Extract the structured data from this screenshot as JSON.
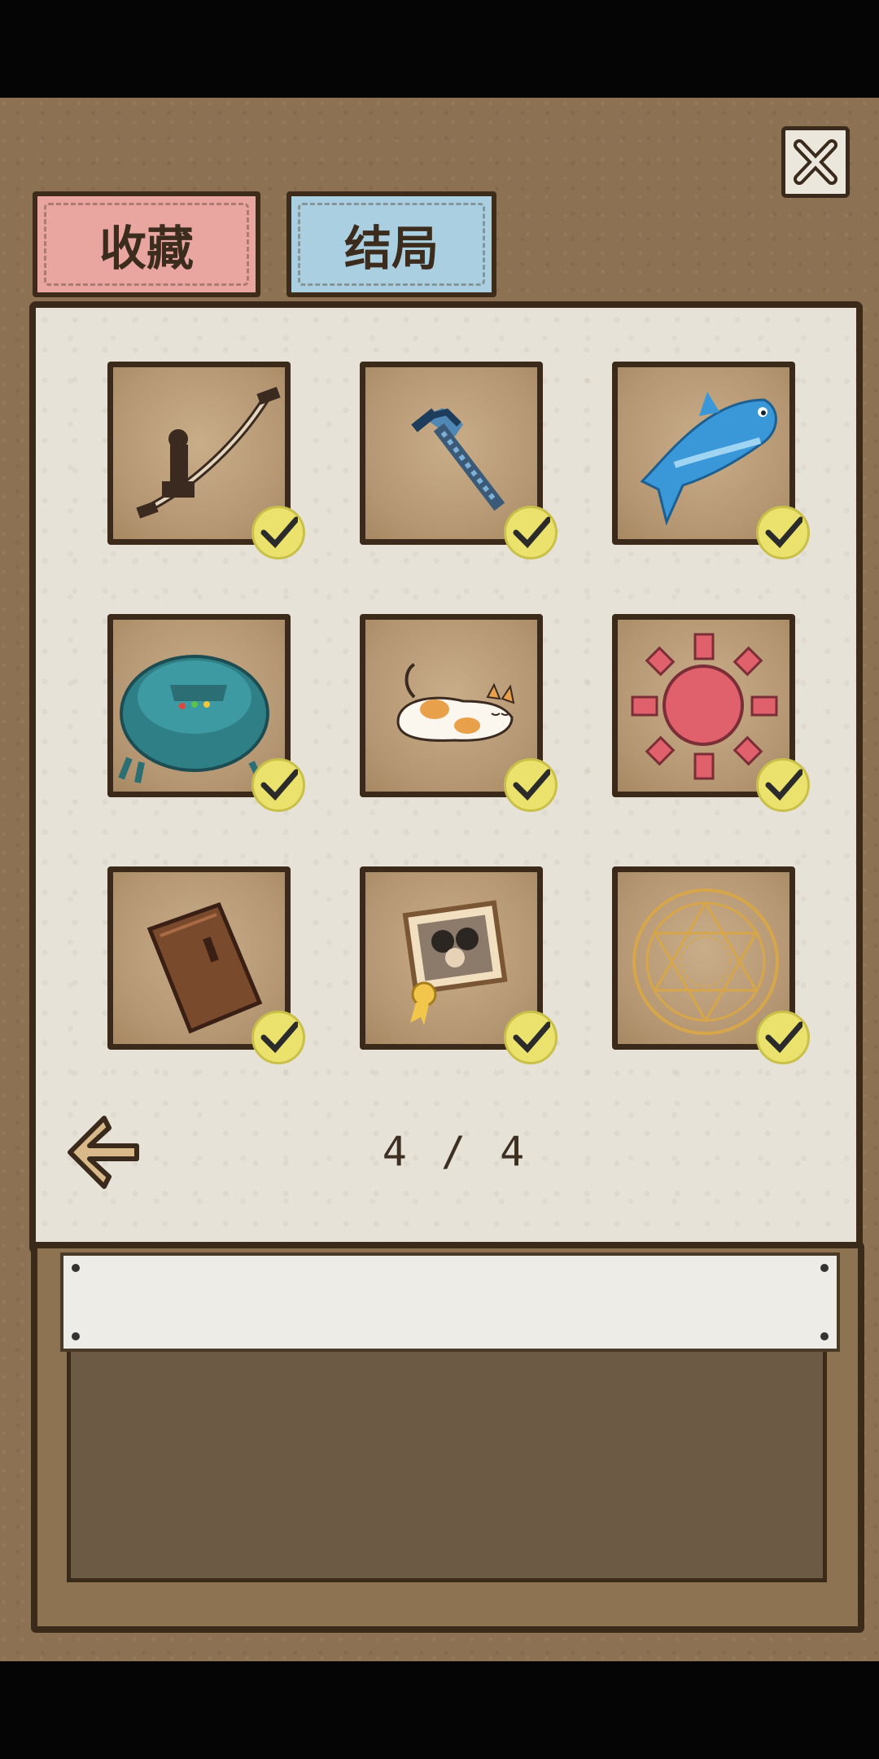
{
  "tabs": {
    "collection_label": "收藏",
    "ending_label": "结局"
  },
  "pager": {
    "page_text": "4 / 4"
  },
  "items": [
    {
      "icon": "slingshot-icon",
      "collected": true
    },
    {
      "icon": "pixel-pickaxe-icon",
      "collected": true
    },
    {
      "icon": "blue-fish-icon",
      "collected": true
    },
    {
      "icon": "teal-robot-vacuum-icon",
      "collected": true
    },
    {
      "icon": "sleeping-cat-icon",
      "collected": true
    },
    {
      "icon": "red-sun-icon",
      "collected": true
    },
    {
      "icon": "wooden-door-icon",
      "collected": true
    },
    {
      "icon": "framed-photo-medal-icon",
      "collected": true
    },
    {
      "icon": "magic-circle-icon",
      "collected": true
    }
  ],
  "colors": {
    "collection_tab": "#e9a6a0",
    "ending_tab": "#a9cfe0",
    "check_badge": "#eae26c"
  }
}
